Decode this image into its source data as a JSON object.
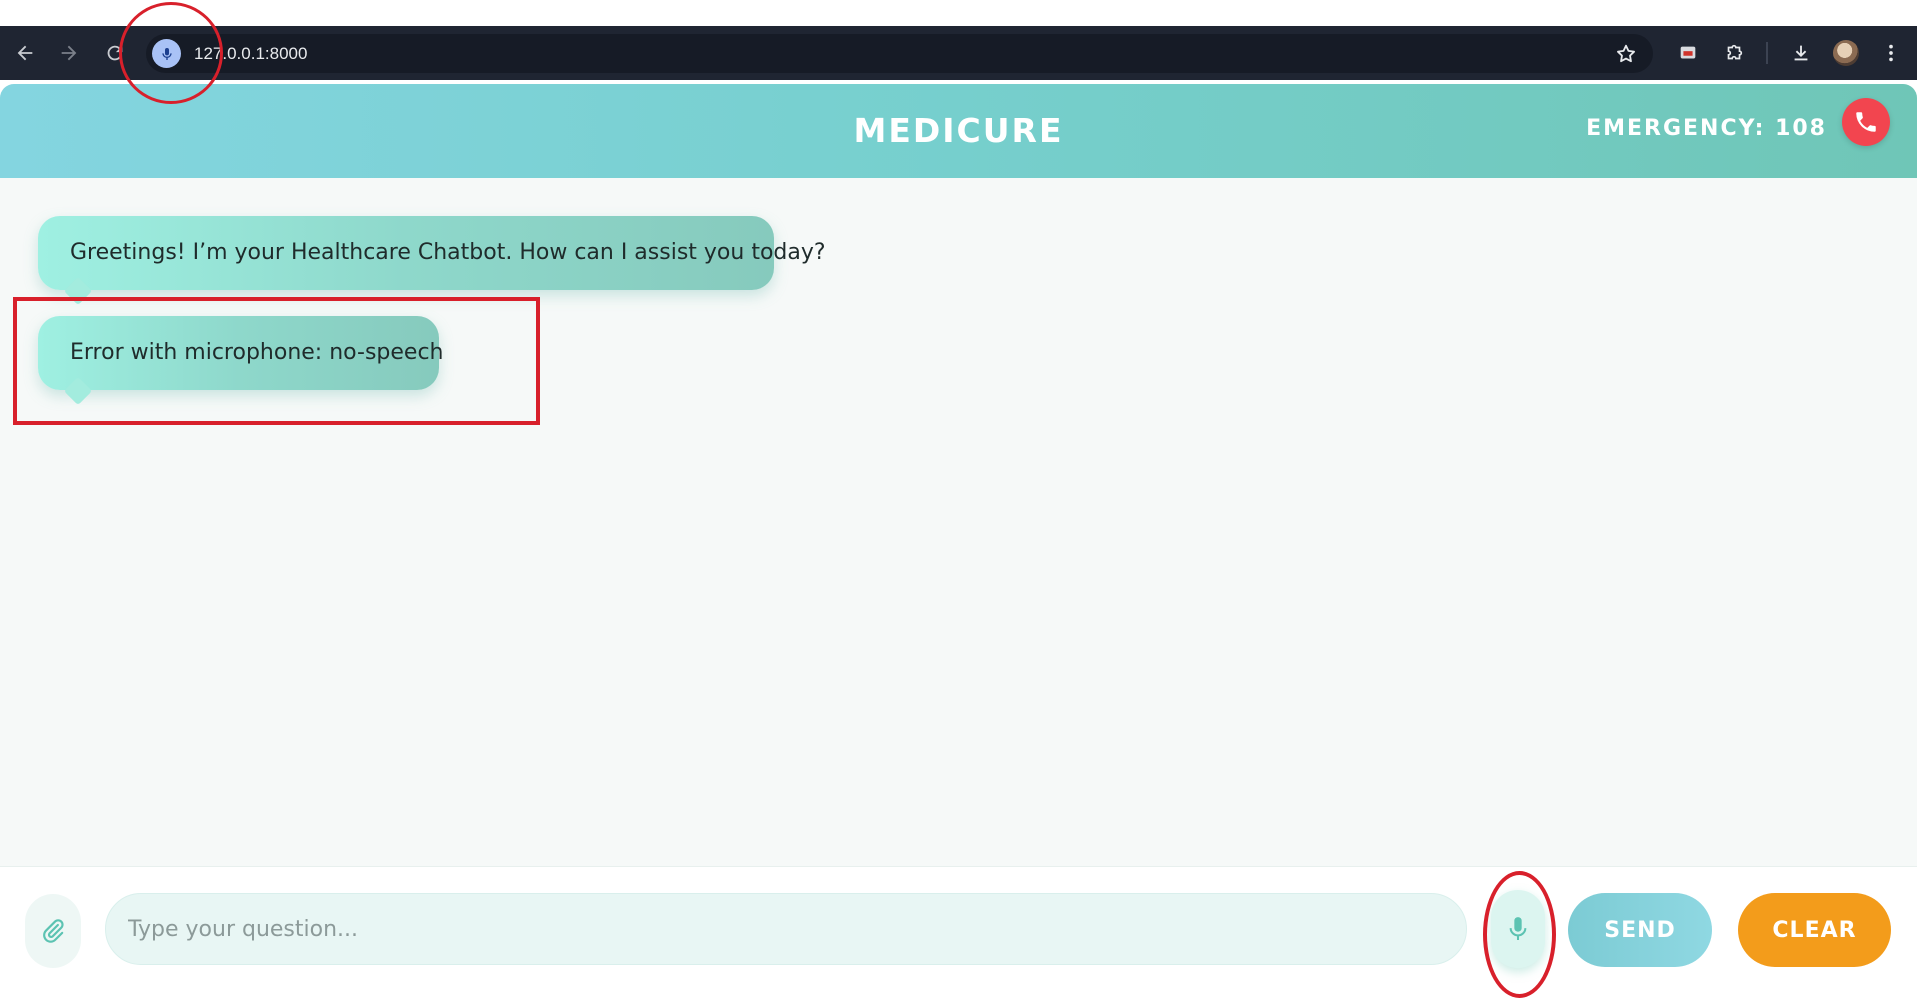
{
  "browser": {
    "url": "127.0.0.1:8000",
    "mic_indicator_icon": "microphone-icon",
    "icons": [
      "back-arrow-icon",
      "forward-arrow-icon",
      "reload-icon",
      "star-icon",
      "cast-icon",
      "extensions-icon",
      "download-icon",
      "avatar",
      "more-vertical-icon"
    ]
  },
  "header": {
    "title": "MEDICURE",
    "emergency_label": "EMERGENCY: 108",
    "call_icon": "phone-icon"
  },
  "messages": [
    {
      "text": "Greetings! I’m your Healthcare Chatbot. How can I assist you today?"
    },
    {
      "text": "Error with microphone: no-speech"
    }
  ],
  "input": {
    "placeholder": "Type your question...",
    "value": "",
    "attach_icon": "paperclip-icon",
    "mic_icon": "microphone-icon",
    "send_label": "SEND",
    "clear_label": "CLEAR"
  },
  "colors": {
    "header_gradient_start": "#84d5e0",
    "header_gradient_end": "#6fc6b7",
    "emergency_call": "#f2454f",
    "send_button": "#8fd8e2",
    "clear_button": "#f39c1b",
    "annotation_red": "#d8202b"
  }
}
